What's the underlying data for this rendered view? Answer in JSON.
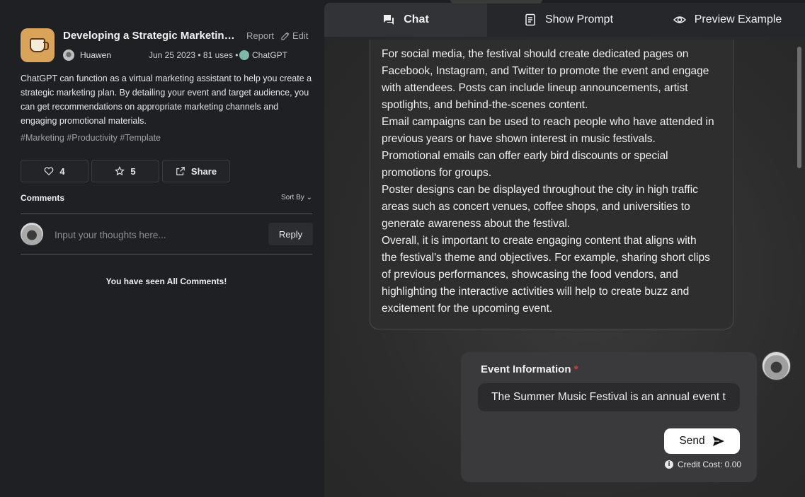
{
  "prompt": {
    "title": "Developing a Strategic Marketing Plan",
    "report_label": "Report",
    "edit_label": "Edit",
    "author": "Huawen",
    "date_uses": "Jun 25 2023 • 81 uses •",
    "model": "ChatGPT",
    "description": "ChatGPT can function as a virtual marketing assistant to help you create a strategic marketing plan. By detailing your event and target audience, you can get recommendations on appropriate marketing channels and engaging promotional materials.",
    "tags": "#Marketing #Productivity #Template",
    "likes": "4",
    "stars": "5",
    "share_label": "Share"
  },
  "comments": {
    "heading": "Comments",
    "sort_label": "Sort By ⌄",
    "input_placeholder": "Input your thoughts here...",
    "reply_label": "Reply",
    "end_message": "You have seen All Comments!"
  },
  "tabs": [
    {
      "label": "Chat",
      "icon": "chat-icon",
      "active": true
    },
    {
      "label": "Show Prompt",
      "icon": "document-icon",
      "active": false
    },
    {
      "label": "Preview Example",
      "icon": "eye-icon",
      "active": false
    }
  ],
  "chat": {
    "response_lines": [
      "For social media, the festival should create dedicated pages on",
      "Facebook, Instagram, and Twitter to promote the event and engage",
      "with attendees. Posts can include lineup announcements, artist",
      "spotlights, and behind-the-scenes content.",
      "Email campaigns can be used to reach people who have attended in",
      "previous years or have shown interest in music festivals.",
      "Promotional emails can offer early bird discounts or special",
      "promotions for groups.",
      "Poster designs can be displayed throughout the city in high traffic",
      "areas such as concert venues, coffee shops, and universities to",
      "generate awareness about the festival.",
      "Overall, it is important to create engaging content that aligns with",
      "the festival's theme and objectives. For example, sharing short clips",
      "of previous performances, showcasing the food vendors, and",
      "highlighting the interactive activities will help to create buzz and",
      "excitement for the upcoming event."
    ]
  },
  "form": {
    "label": "Event Information",
    "required_mark": "*",
    "input_value": "The Summer Music Festival is an annual event t",
    "send_label": "Send",
    "credit_text": "Credit Cost: 0.00"
  },
  "colors": {
    "accent_required": "#d83a3a",
    "app_icon_bg": "#d9a35a"
  }
}
